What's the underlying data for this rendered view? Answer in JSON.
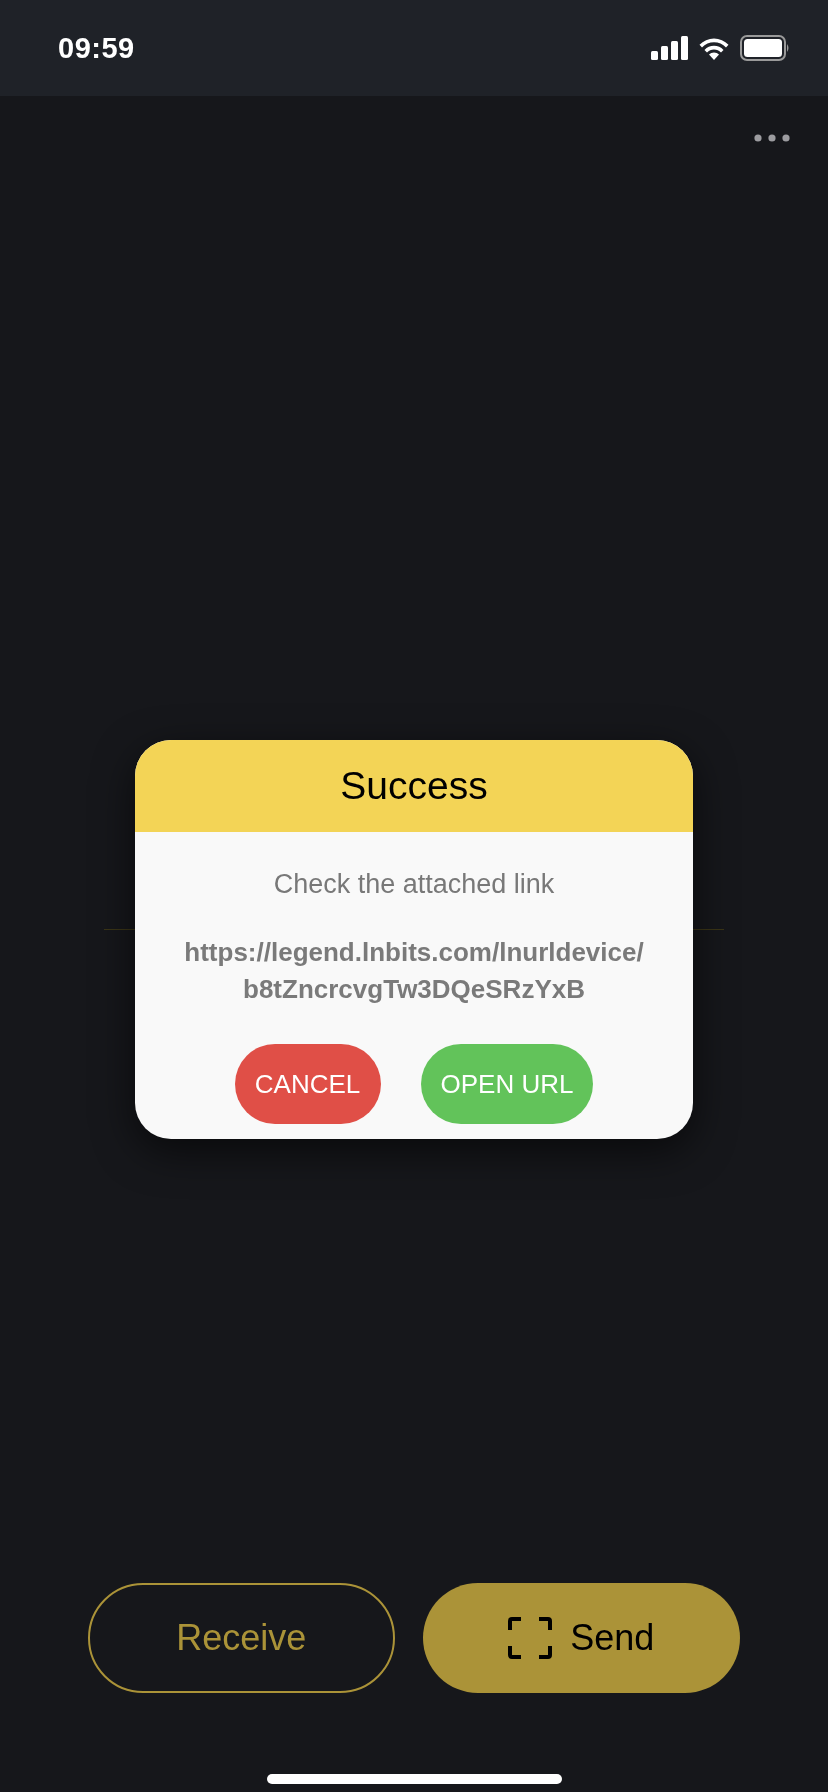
{
  "status_bar": {
    "time": "09:59"
  },
  "dialog": {
    "title": "Success",
    "message": "Check the attached link",
    "url": "https://legend.lnbits.com/lnurldevice/ b8tZncrcvgTw3DQeSRzYxB",
    "buttons": [
      {
        "label": "CANCEL",
        "kind": "cancel"
      },
      {
        "label": "OPEN URL",
        "kind": "confirm"
      }
    ]
  },
  "actions": [
    {
      "label": "Receive",
      "kind": "outline"
    },
    {
      "label": "Send",
      "kind": "filled"
    }
  ]
}
